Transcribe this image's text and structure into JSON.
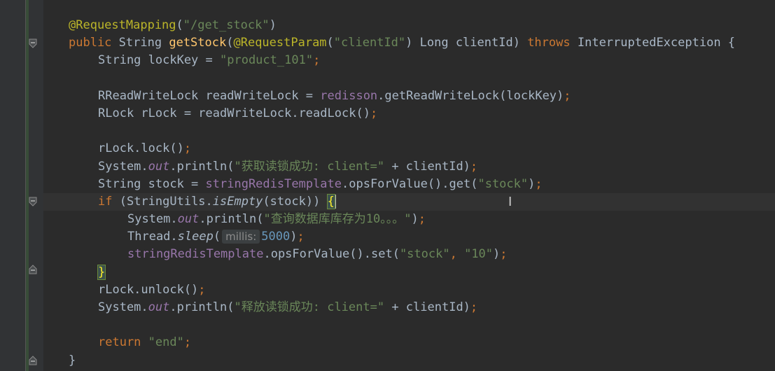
{
  "code": {
    "l1_annotation": "@RequestMapping",
    "l1_arg": "\"/get_stock\"",
    "l2_public": "public",
    "l2_type": "String",
    "l2_method": "getStock",
    "l2_param_ann": "@RequestParam",
    "l2_param_ann_arg": "\"clientId\"",
    "l2_param": "Long clientId)",
    "l2_throws": "throws",
    "l2_exception": "InterruptedException {",
    "l3_decl": "String lockKey = ",
    "l3_value": "\"product_101\"",
    "l5_decl": "RReadWriteLock readWriteLock = ",
    "l5_field": "redisson",
    "l5_call": ".getReadWriteLock(lockKey)",
    "l6_decl": "RLock rLock = readWriteLock.readLock()",
    "l8_call": "rLock.lock()",
    "l9_system": "System.",
    "l9_out": "out",
    "l9_println": ".println(",
    "l9_str": "\"获取读锁成功: client=\"",
    "l9_rest": " + clientId)",
    "l10_decl": "String stock = ",
    "l10_field": "stringRedisTemplate",
    "l10_call": ".opsForValue().get(",
    "l10_str": "\"stock\"",
    "l11_if": "if",
    "l11_cond_a": " (StringUtils.",
    "l11_cond_method": "isEmpty",
    "l11_cond_b": "(stock)) ",
    "l11_brace": "{",
    "l12_system": "System.",
    "l12_out": "out",
    "l12_println": ".println(",
    "l12_str": "\"查询数据库库存为10。。。\"",
    "l13_thread": "Thread.",
    "l13_sleep": "sleep",
    "l13_hint": "millis:",
    "l13_num": "5000",
    "l14_field": "stringRedisTemplate",
    "l14_call": ".opsForValue().set(",
    "l14_str1": "\"stock\"",
    "l14_str2": "\"10\"",
    "l15_brace": "}",
    "l16_call": "rLock.unlock()",
    "l17_system": "System.",
    "l17_out": "out",
    "l17_println": ".println(",
    "l17_str": "\"释放读锁成功: client=\"",
    "l17_rest": " + clientId)",
    "l19_return": "return",
    "l19_str": "\"end\"",
    "l20_brace": "}"
  }
}
